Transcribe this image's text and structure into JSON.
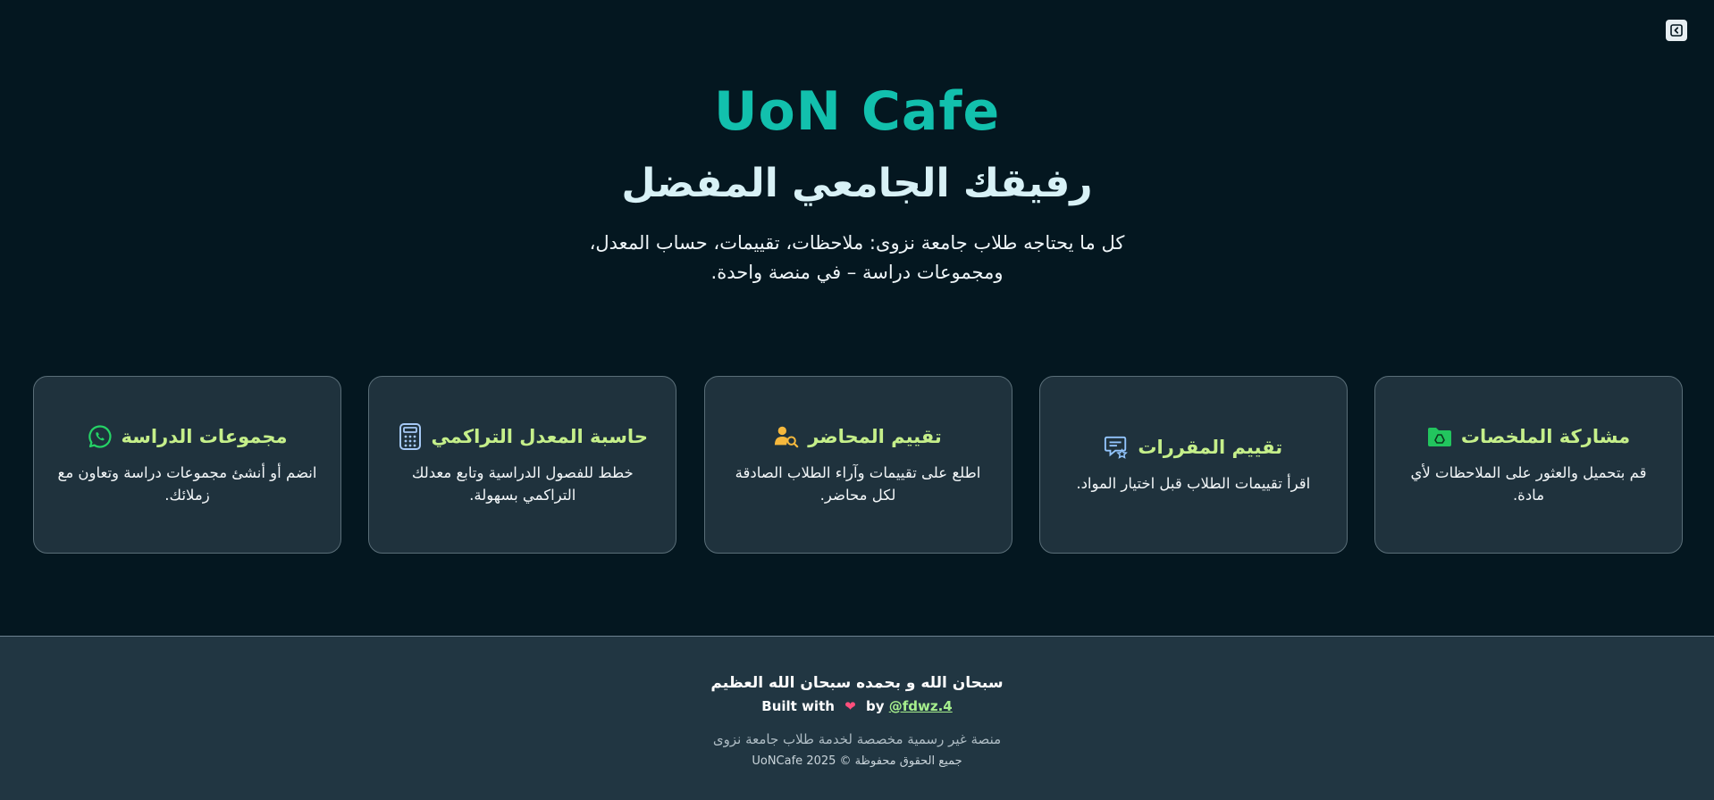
{
  "sidebar_toggle": {
    "icon": "chevron-left-icon"
  },
  "hero": {
    "brand": "UoN Cafe",
    "tagline": "رفيقك الجامعي المفضل",
    "intro_line1": "كل ما يحتاجه طلاب جامعة نزوى: ملاحظات، تقييمات، حساب المعدل،",
    "intro_line2": "ومجموعات دراسة – في منصة واحدة."
  },
  "features": [
    {
      "title": "مشاركة الملخصات",
      "description": "قم بتحميل والعثور على الملاحظات لأي مادة.",
      "icon": "google-drive-folder-icon",
      "icon_color": "#22c55e"
    },
    {
      "title": "تقييم المقررات",
      "description": "اقرأ تقييمات الطلاب قبل اختيار المواد.",
      "icon": "review-icon",
      "icon_color": "#93c5fd"
    },
    {
      "title": "تقييم المحاضر",
      "description": "اطلع على تقييمات وآراء الطلاب الصادقة لكل محاضر.",
      "icon": "user-search-icon",
      "icon_color": "#f5b83d"
    },
    {
      "title": "حاسبة المعدل التراكمي",
      "description": "خطط للفصول الدراسية وتابع معدلك التراكمي بسهولة.",
      "icon": "calculator-icon",
      "icon_color": "#a5c8f5"
    },
    {
      "title": "مجموعات الدراسة",
      "description": "انضم أو أنشئ مجموعات دراسة وتعاون مع زملائك.",
      "icon": "whatsapp-icon",
      "icon_color": "#25d366"
    }
  ],
  "footer": {
    "dhikr": "سبحان الله و بحمده سبحان الله العظيم",
    "built_prefix": "Built with",
    "built_by": "by",
    "author_link": "@fdwz.4",
    "note": "منصة غير رسمية مخصصة لخدمة طلاب جامعة نزوى",
    "copyright": "جميع الحقوق محفوظة © 2025 UoNCafe"
  },
  "colors": {
    "background": "#041720",
    "brand": "#12c0ad",
    "card_title": "#c5ef8a",
    "card_bg": "#1f323d",
    "footer_bg": "#213642"
  }
}
